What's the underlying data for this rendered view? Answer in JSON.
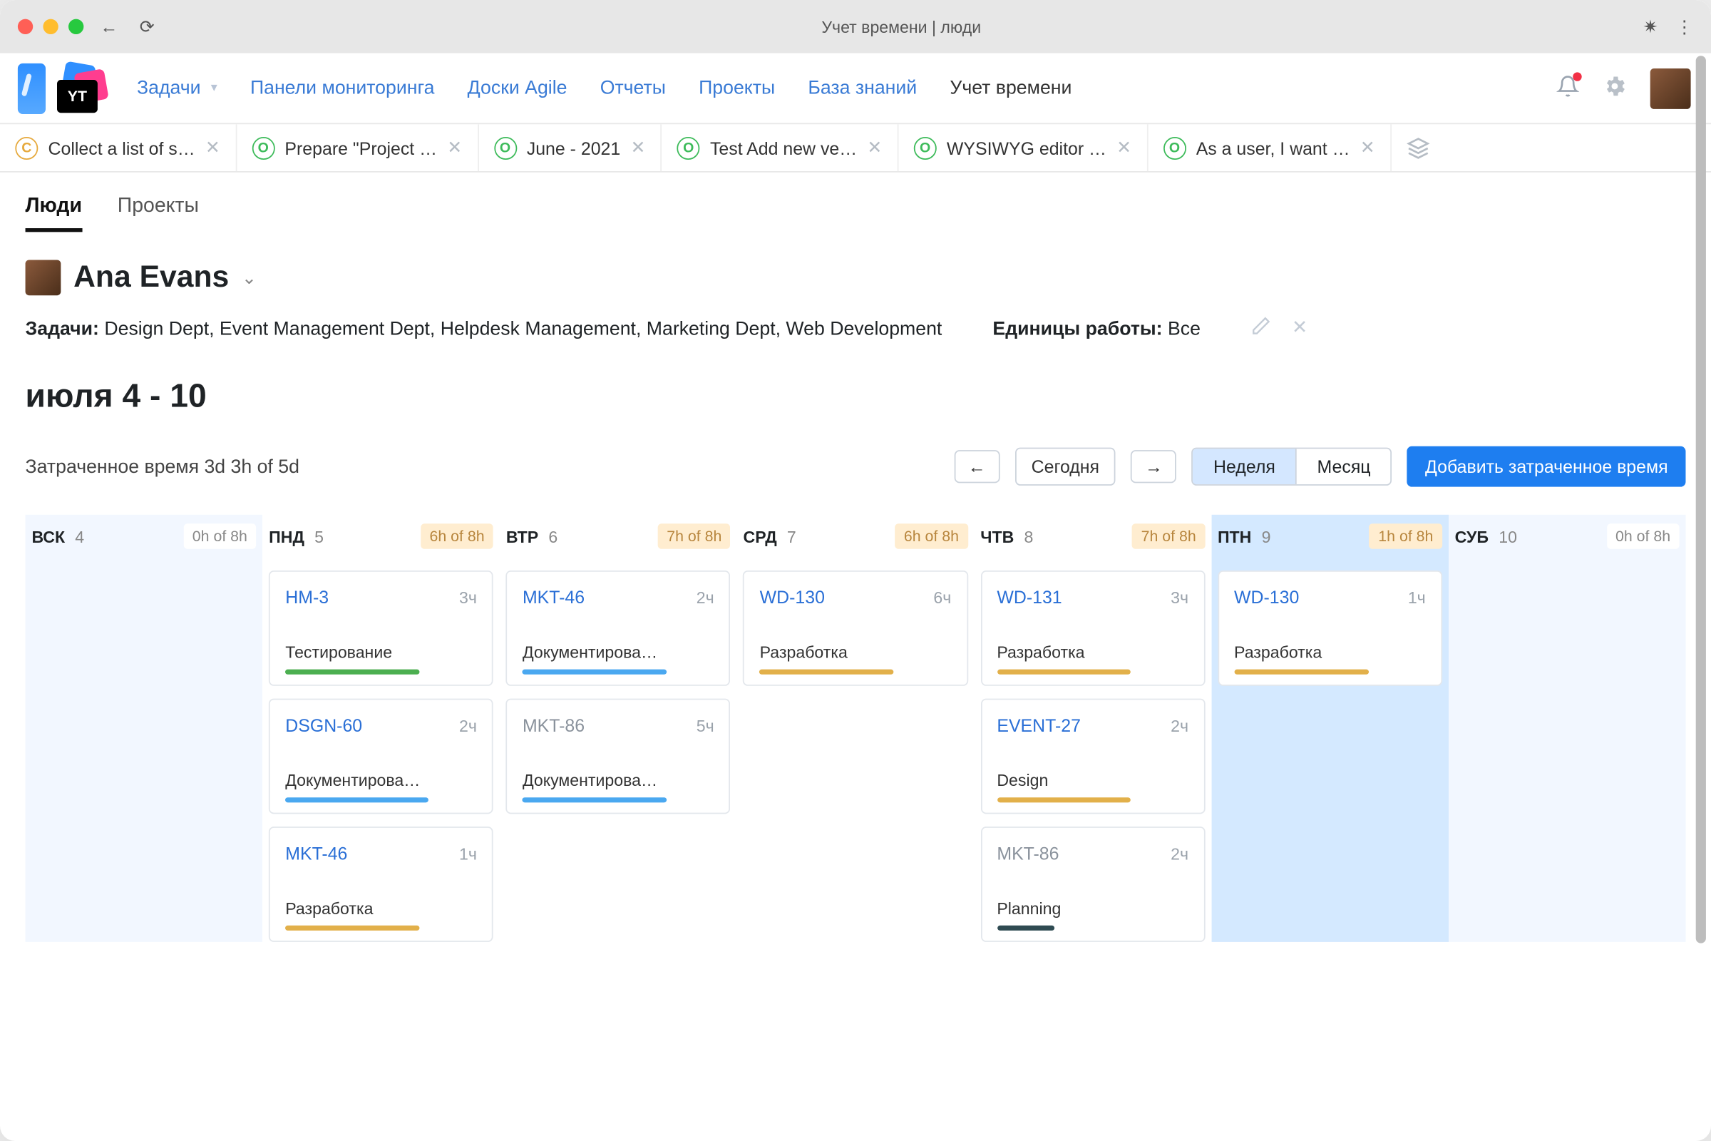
{
  "chrome": {
    "title": "Учет времени | люди"
  },
  "nav": {
    "items": [
      "Задачи",
      "Панели мониторинга",
      "Доски Agile",
      "Отчеты",
      "Проекты",
      "База знаний",
      "Учет времени"
    ],
    "active": "Учет времени"
  },
  "tabs": [
    {
      "badge": "C",
      "color": "c",
      "label": "Collect a list of s…"
    },
    {
      "badge": "O",
      "color": "o",
      "label": "Prepare \"Project …"
    },
    {
      "badge": "O",
      "color": "o",
      "label": "June - 2021"
    },
    {
      "badge": "O",
      "color": "o",
      "label": "Test Add new ve…"
    },
    {
      "badge": "O",
      "color": "o",
      "label": "WYSIWYG editor …"
    },
    {
      "badge": "O",
      "color": "o",
      "label": "As a user, I want …"
    }
  ],
  "viewTabs": {
    "people": "Люди",
    "projects": "Проекты"
  },
  "user": {
    "name": "Ana Evans"
  },
  "filters": {
    "tasksLabel": "Задачи:",
    "tasksValue": "Design Dept, Event Management Dept, Helpdesk Management, Marketing Dept, Web Development",
    "unitsLabel": "Единицы работы:",
    "unitsValue": "Все"
  },
  "range": "июля 4 - 10",
  "spent": "Затраченное время 3d 3h of 5d",
  "controls": {
    "today": "Сегодня",
    "week": "Неделя",
    "month": "Месяц",
    "add": "Добавить затраченное время"
  },
  "days": [
    {
      "dow": "ВСК",
      "num": "4",
      "pill": "0h of 8h",
      "pillWarm": false,
      "off": true,
      "today": false,
      "cards": []
    },
    {
      "dow": "ПНД",
      "num": "5",
      "pill": "6h of 8h",
      "pillWarm": true,
      "off": false,
      "today": false,
      "cards": [
        {
          "id": "HM-3",
          "muted": false,
          "hrs": "3ч",
          "title": "Тестирование",
          "stripe": "green"
        },
        {
          "id": "DSGN-60",
          "muted": false,
          "hrs": "2ч",
          "title": "Документирова…",
          "stripe": "blue"
        },
        {
          "id": "MKT-46",
          "muted": false,
          "hrs": "1ч",
          "title": "Разработка",
          "stripe": "gold"
        }
      ]
    },
    {
      "dow": "ВТР",
      "num": "6",
      "pill": "7h of 8h",
      "pillWarm": true,
      "off": false,
      "today": false,
      "cards": [
        {
          "id": "MKT-46",
          "muted": false,
          "hrs": "2ч",
          "title": "Документирова…",
          "stripe": "blue"
        },
        {
          "id": "MKT-86",
          "muted": true,
          "hrs": "5ч",
          "title": "Документирова…",
          "stripe": "blue"
        }
      ]
    },
    {
      "dow": "СРД",
      "num": "7",
      "pill": "6h of 8h",
      "pillWarm": true,
      "off": false,
      "today": false,
      "cards": [
        {
          "id": "WD-130",
          "muted": false,
          "hrs": "6ч",
          "title": "Разработка",
          "stripe": "gold"
        }
      ]
    },
    {
      "dow": "ЧТВ",
      "num": "8",
      "pill": "7h of 8h",
      "pillWarm": true,
      "off": false,
      "today": false,
      "cards": [
        {
          "id": "WD-131",
          "muted": false,
          "hrs": "3ч",
          "title": "Разработка",
          "stripe": "gold"
        },
        {
          "id": "EVENT-27",
          "muted": false,
          "hrs": "2ч",
          "title": "Design",
          "stripe": "gold"
        },
        {
          "id": "MKT-86",
          "muted": true,
          "hrs": "2ч",
          "title": "Planning",
          "stripe": "teal"
        }
      ]
    },
    {
      "dow": "ПТН",
      "num": "9",
      "pill": "1h of 8h",
      "pillWarm": true,
      "off": false,
      "today": true,
      "cards": [
        {
          "id": "WD-130",
          "muted": false,
          "hrs": "1ч",
          "title": "Разработка",
          "stripe": "gold"
        }
      ]
    },
    {
      "dow": "СУБ",
      "num": "10",
      "pill": "0h of 8h",
      "pillWarm": false,
      "off": true,
      "today": false,
      "cards": []
    }
  ]
}
